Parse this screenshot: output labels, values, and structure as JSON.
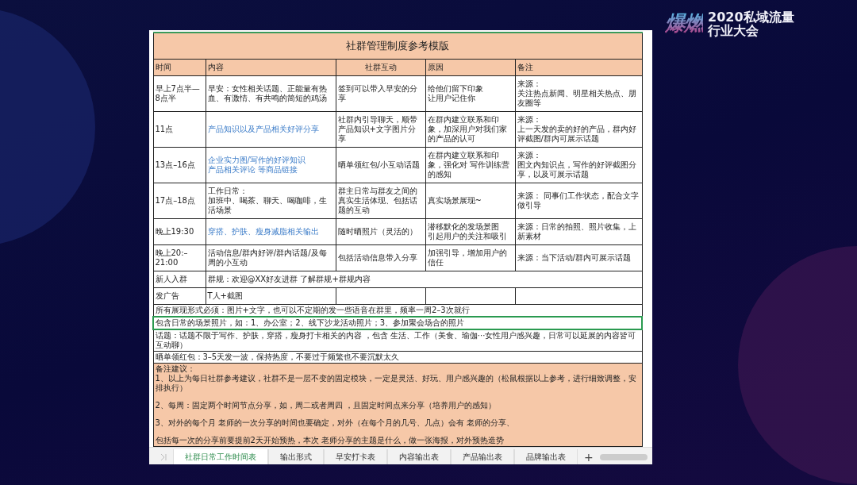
{
  "logo": {
    "mark": "爆燃",
    "line1": "2020私域流量",
    "line2": "行业大会"
  },
  "sheet": {
    "title": "社群管理制度参考模版",
    "columns": [
      "时间",
      "内容",
      "社群互动",
      "原因",
      "备注"
    ],
    "rows": [
      {
        "cells": [
          "早上7点半—8点半",
          "早安：女性相关话题、正能量有热血、有激情、有共鸣的简短的鸡汤",
          "签到可以带入早安的分享",
          [
            "给他们留下印象",
            "让用户记住你"
          ],
          [
            "来源：",
            "关注热点新闻、明星相关热点、朋友圈等"
          ]
        ],
        "merged": false,
        "content_accent": false
      },
      {
        "cells": [
          "11点",
          "产品知识以及产品相关好评分享",
          "社群内引导聊天，顺带产品知识+文字图片分享",
          "在群内建立联系和印象，加深用户对我们家的产品的认可",
          [
            "来源：",
            "上一天发的卖的好的产品，群内好评截图/群内可展示话题"
          ]
        ],
        "merged": false,
        "content_accent": true
      },
      {
        "cells": [
          "13点–16点",
          [
            "企业实力图/写作的好评知识",
            "产品相关评论 等商品链接"
          ],
          "晒单领红包/小互动话题",
          "在群内建立联系和印象，强化对 写作训练营的感知",
          [
            "来源：",
            "图文内知识点，写作的好评截图分享，以及可展示话题"
          ]
        ],
        "merged": false,
        "content_accent": true
      },
      {
        "cells": [
          "17点–18点",
          [
            "工作日常：",
            "加班中、喝茶、聊天、喝咖啡，生活场景"
          ],
          "群主日常与群友之间的真实生活体现、包括话题的互动",
          "真实场景展现~",
          "来源： 同事们工作状态，配合文字做引导"
        ],
        "merged": false,
        "content_accent": false
      },
      {
        "cells": [
          "晚上19:30",
          "穿搭、护肤、瘦身减脂相关输出",
          "随时晒照片（灵活的）",
          [
            "潜移默化的发场景图",
            "引起用户的关注和吸引"
          ],
          "来源：日常的拍照、照片收集，上新素材"
        ],
        "merged": false,
        "content_accent": true
      },
      {
        "cells": [
          "晚上20:–21:00",
          "活动信息/群内好评/群内话题/及每周的小互动",
          "包括活动信息带入分享",
          "加强引导，增加用户的信任",
          "来源：当下活动/群内可展示话题"
        ],
        "merged": false,
        "content_accent": false
      },
      {
        "cells": [
          "新人入群",
          "群规：欢迎@XX好友进群  了解群规+群规内容",
          "",
          "",
          ""
        ],
        "merged": true,
        "content_accent": false
      },
      {
        "cells": [
          "发广告",
          "T人+截图",
          "",
          "",
          ""
        ],
        "merged": false,
        "content_accent": false
      }
    ],
    "remarks": [
      {
        "text": "所有展现形式必须：图片+文字，也可以不定期的发一些语音在群里，频率一周2–3次就行",
        "selected": false
      },
      {
        "text": "包含日常的场景照片，如：1、办公室；2、线下沙龙活动照片；3、参加聚会场合的照片",
        "selected": true
      },
      {
        "text": "话题：话题不限于写作、护肤，穿搭，瘦身打卡相关的内容 ，包含 生活、工作（美食、瑜伽···女性用户感兴趣，日常可以延展的内容皆可互动聊）",
        "selected": false
      },
      {
        "text": "晒单领红包：3–5天发一波，保持热度，不要过于频繁也不要沉默太久",
        "selected": false
      }
    ],
    "advice": {
      "title": "备注建议：",
      "paragraphs": [
        "1、以上为每日社群参考建议，社群不是一层不变的固定模块，一定是灵活、好玩、用户感兴趣的（松鼠根据以上参考，进行细致调整，安排执行）",
        "2、每周：固定两个时间节点分享，如，周二或者周四 ，且固定时间点来分享（培养用户的感知）",
        "3、对外的每个月  老师的一次分享的时间也要确定，对外（在每个月的几号、几点）会有  老师的分享、",
        "包括每一次的分享前要提前2天开始预热，本次  老师分享的主题是什么，做一张海报，对外预热造势"
      ]
    }
  },
  "sheet_tabs": [
    {
      "label": "社群日常工作时间表",
      "selected": true
    },
    {
      "label": "输出形式",
      "selected": false
    },
    {
      "label": "早安打卡表",
      "selected": false
    },
    {
      "label": "内容输出表",
      "selected": false
    },
    {
      "label": "产品输出表",
      "selected": false
    },
    {
      "label": "品牌输出表",
      "selected": false
    }
  ],
  "add_sheet": "+"
}
